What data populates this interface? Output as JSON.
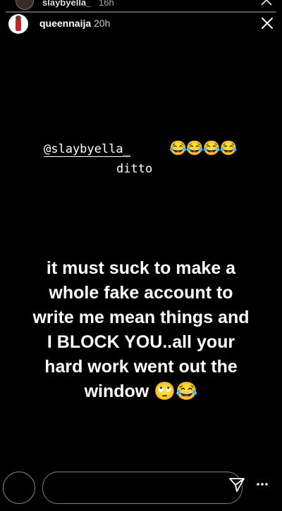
{
  "previous_story": {
    "username": "slaybyella_",
    "time": "16h"
  },
  "progress": {
    "fraction": 0.0
  },
  "header": {
    "username": "queennaija",
    "time": "20h"
  },
  "mention_sticker": {
    "handle": "@slaybyella_",
    "emojis": "😂😂😂😂",
    "reply": "ditto"
  },
  "caption": {
    "lines": [
      "it must suck to make a",
      "whole fake account to",
      "write me mean things and",
      "I BLOCK YOU..all your",
      "hard work went out the",
      "window 🙄😂"
    ]
  },
  "icons": {
    "close": "close-icon",
    "send": "send-icon",
    "more": "more-icon"
  }
}
